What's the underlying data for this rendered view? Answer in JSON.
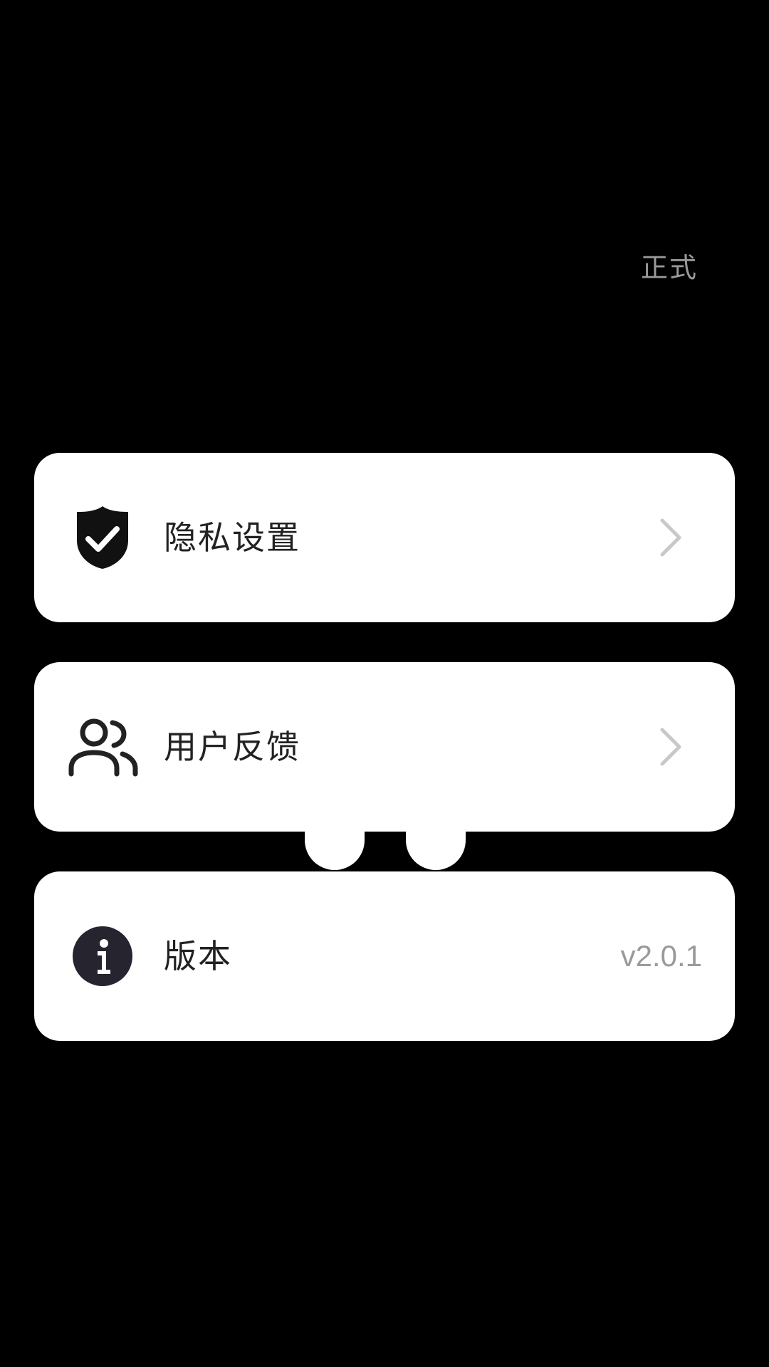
{
  "env_label": "正式",
  "menu": {
    "privacy": {
      "label": "隐私设置",
      "icon": "shield-check-icon"
    },
    "feedback": {
      "label": "用户反馈",
      "icon": "users-icon"
    },
    "version": {
      "label": "版本",
      "icon": "info-icon",
      "value": "v2.0.1"
    }
  },
  "colors": {
    "background": "#000000",
    "card": "#ffffff",
    "label_text": "#222222",
    "secondary_text": "#9a9a9a",
    "icon_dark": "#25242f"
  }
}
